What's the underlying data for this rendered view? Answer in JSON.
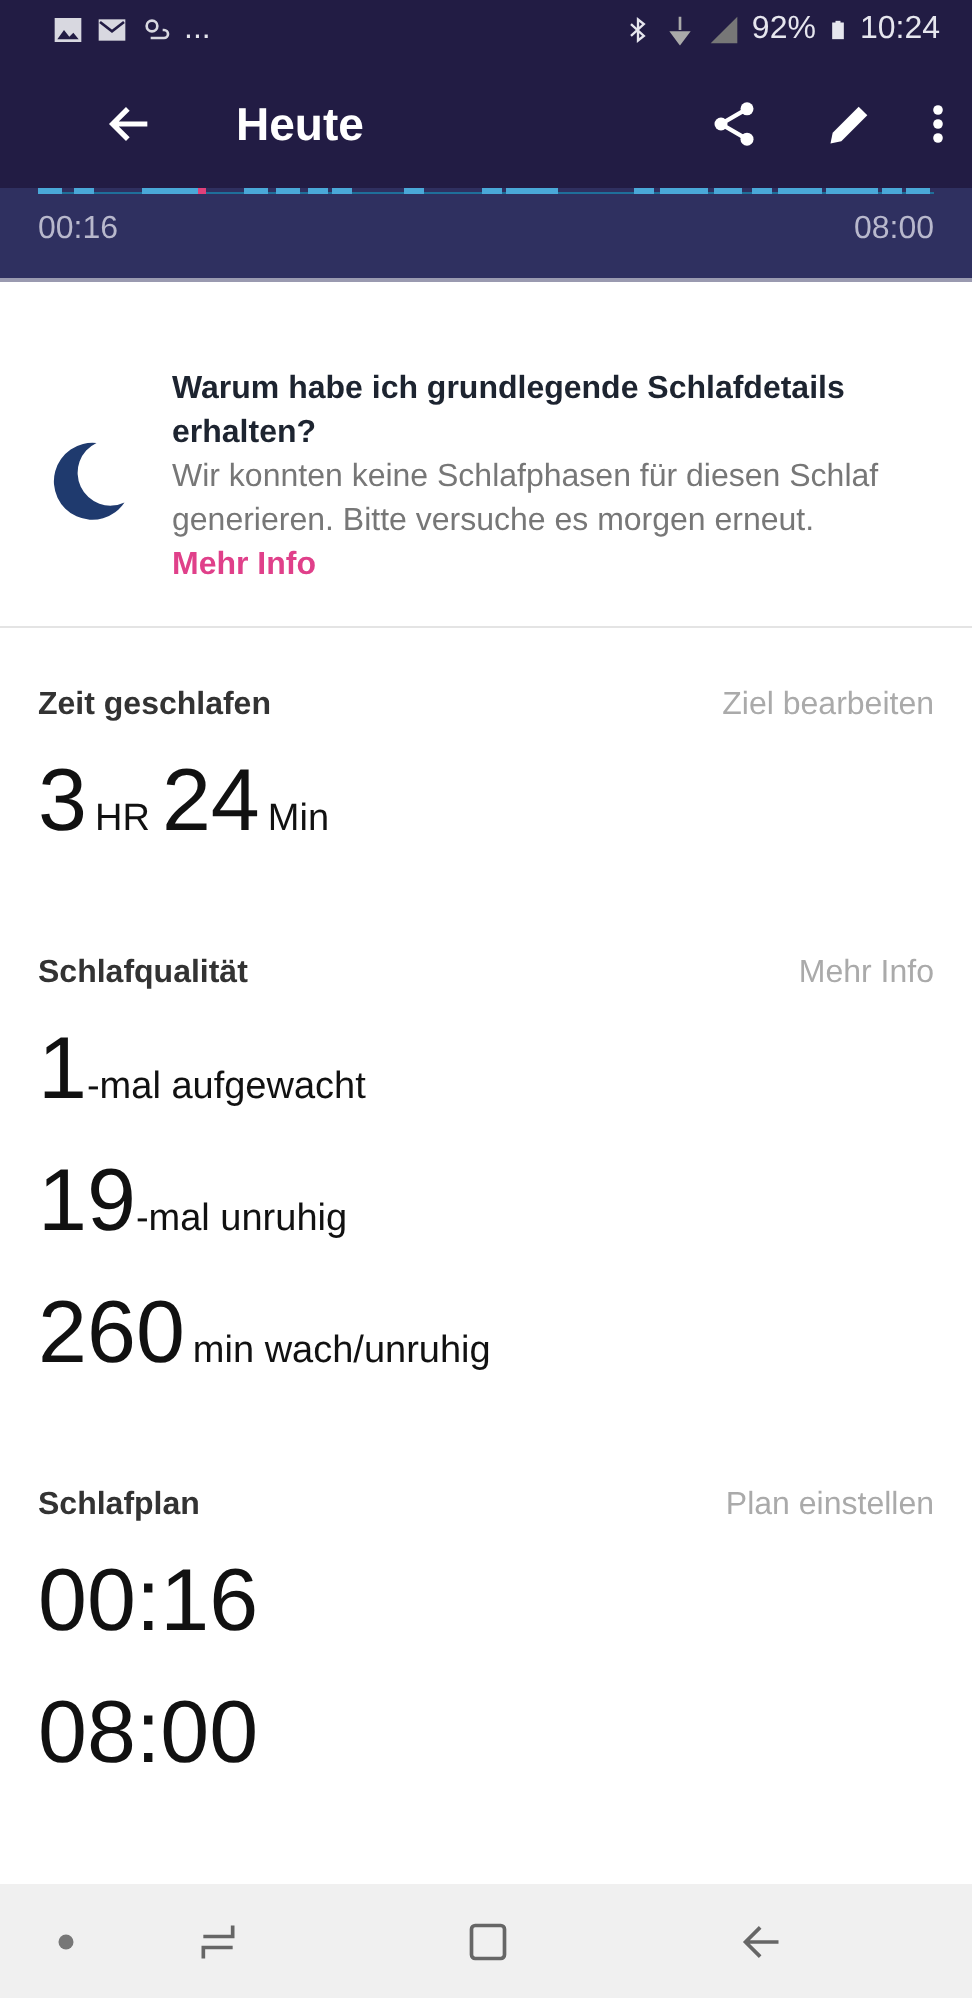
{
  "status_bar": {
    "overflow": "...",
    "battery": "92%",
    "time": "10:24"
  },
  "app_bar": {
    "title": "Heute"
  },
  "timeline": {
    "start": "00:16",
    "end": "08:00"
  },
  "info_card": {
    "title": "Warum habe ich grundlegende Schlafdetails erhalten?",
    "body": "Wir konnten keine Schlafphasen für diesen Schlaf generieren. Bitte versuche es morgen erneut.",
    "link": "Mehr Info"
  },
  "sections": [
    {
      "title": "Zeit geschlafen",
      "action": "Ziel bearbeiten",
      "lines": [
        {
          "parts": [
            {
              "text": "3",
              "kind": "big"
            },
            {
              "text": "HR",
              "kind": "small"
            },
            {
              "text": "24",
              "kind": "big"
            },
            {
              "text": "Min",
              "kind": "small"
            }
          ]
        }
      ]
    },
    {
      "title": "Schlafqualität",
      "action": "Mehr Info",
      "lines": [
        {
          "parts": [
            {
              "text": "1",
              "kind": "big"
            },
            {
              "text": "-mal aufgewacht",
              "kind": "suffix"
            }
          ]
        },
        {
          "parts": [
            {
              "text": "19",
              "kind": "big"
            },
            {
              "text": "-mal unruhig",
              "kind": "suffix"
            }
          ]
        },
        {
          "parts": [
            {
              "text": "260",
              "kind": "big"
            },
            {
              "text": "min wach/unruhig",
              "kind": "small"
            }
          ]
        }
      ]
    },
    {
      "title": "Schlafplan",
      "action": "Plan einstellen",
      "lines": [
        {
          "parts": [
            {
              "text": "00:16",
              "kind": "big"
            }
          ]
        },
        {
          "parts": [
            {
              "text": "08:00",
              "kind": "big"
            }
          ]
        }
      ]
    }
  ]
}
